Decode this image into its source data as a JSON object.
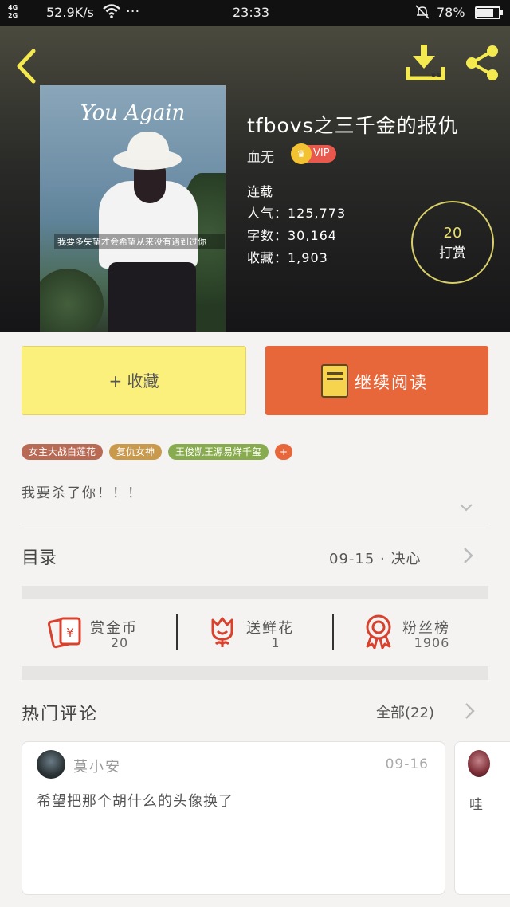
{
  "status_bar": {
    "network_top": "4G",
    "network_bottom": "2G",
    "speed": "52.9K/s",
    "time": "23:33",
    "battery_text": "78%",
    "battery_level": 0.78
  },
  "book": {
    "title": "tfbovs之三千金的报仇",
    "author": "血无",
    "vip_label": "VIP",
    "serial_status": "连载",
    "popularity": "人气：125,773",
    "word_count": "字数：30,164",
    "favorites": "收藏：1,903",
    "cover_title": "You Again",
    "cover_caption": "我要多失望才会希望从来没有遇到过你"
  },
  "tip_button": {
    "count": "20",
    "label": "打赏"
  },
  "actions": {
    "favorite_label": "+ 收藏",
    "continue_label": "继续阅读"
  },
  "tags": [
    "女主大战白莲花",
    "复仇女神",
    "王俊凯王源易烊千玺",
    "+"
  ],
  "description": "我要杀了你！！！",
  "catalog": {
    "title": "目录",
    "latest": "09-15 · 决心"
  },
  "rewards": [
    {
      "label": "赏金币",
      "value": "20",
      "icon": "red-envelope-icon"
    },
    {
      "label": "送鲜花",
      "value": "1",
      "icon": "flower-icon"
    },
    {
      "label": "粉丝榜",
      "value": "1906",
      "icon": "medal-icon"
    }
  ],
  "comments_section": {
    "title": "热门评论",
    "all_label": "全部(22)"
  },
  "comments": [
    {
      "user": "莫小安",
      "date": "09-16",
      "text": "希望把那个胡什么的头像换了"
    },
    {
      "user": "",
      "date": "",
      "text": "哇"
    }
  ],
  "colors": {
    "accent_orange": "#e8673a",
    "favorite_yellow": "#fbf07c",
    "reward_red": "#d9412f",
    "tip_gold": "#d8cf6a"
  }
}
